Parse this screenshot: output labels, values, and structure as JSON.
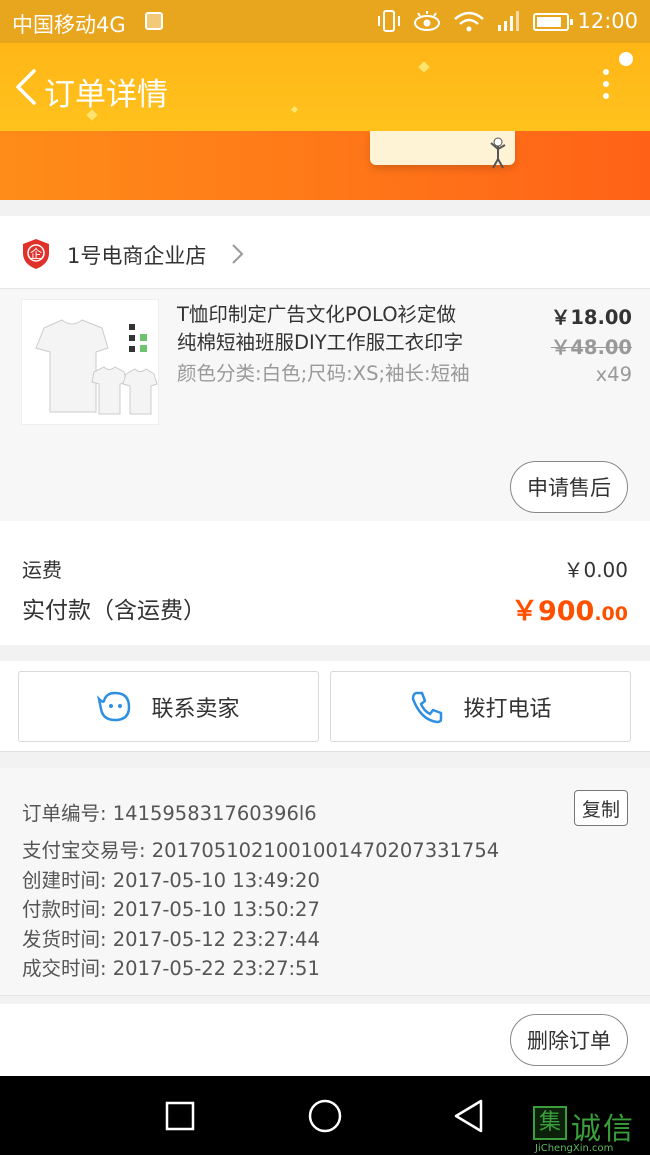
{
  "status_bar": {
    "carrier": "中国移动4G",
    "network_badge": "4G",
    "time": "12:00"
  },
  "header": {
    "title": "订单详情"
  },
  "store": {
    "name": "1号电商企业店",
    "badge_char": "企"
  },
  "product": {
    "title_line1": "T恤印制定广告文化POLO衫定做",
    "title_line2": "纯棉短袖班服DIY工作服工衣印字",
    "spec": "颜色分类:白色;尺码:XS;袖长:短袖",
    "price": "￥18.00",
    "original_price": "￥48.00",
    "quantity": "x49",
    "after_sale_label": "申请售后"
  },
  "fees": {
    "shipping_label": "运费",
    "shipping_value": "￥0.00",
    "paid_label": "实付款（含运费）",
    "paid_value_main": "￥900",
    "paid_value_decimal": ".00"
  },
  "contact": {
    "seller_label": "联系卖家",
    "phone_label": "拨打电话"
  },
  "order_info": {
    "order_no": "订单编号: 141595831760396l6",
    "alipay_no": "支付宝交易号: 2017051021001001470207331754",
    "created": "创建时间: 2017-05-10 13:49:20",
    "paid": "付款时间: 2017-05-10 13:50:27",
    "shipped": "发货时间: 2017-05-12 23:27:44",
    "completed": "成交时间: 2017-05-22 23:27:51",
    "copy_label": "复制"
  },
  "bottom": {
    "delete_label": "删除订单"
  },
  "watermark": {
    "text": "诚信",
    "box_char": "集",
    "sub": "JiChengXin.com"
  },
  "colors": {
    "status_bar": "#e8a51e",
    "header": "#ffb617",
    "banner": "#ff7418",
    "price_accent": "#ff5000",
    "phone_icon": "#2f8fe0"
  }
}
